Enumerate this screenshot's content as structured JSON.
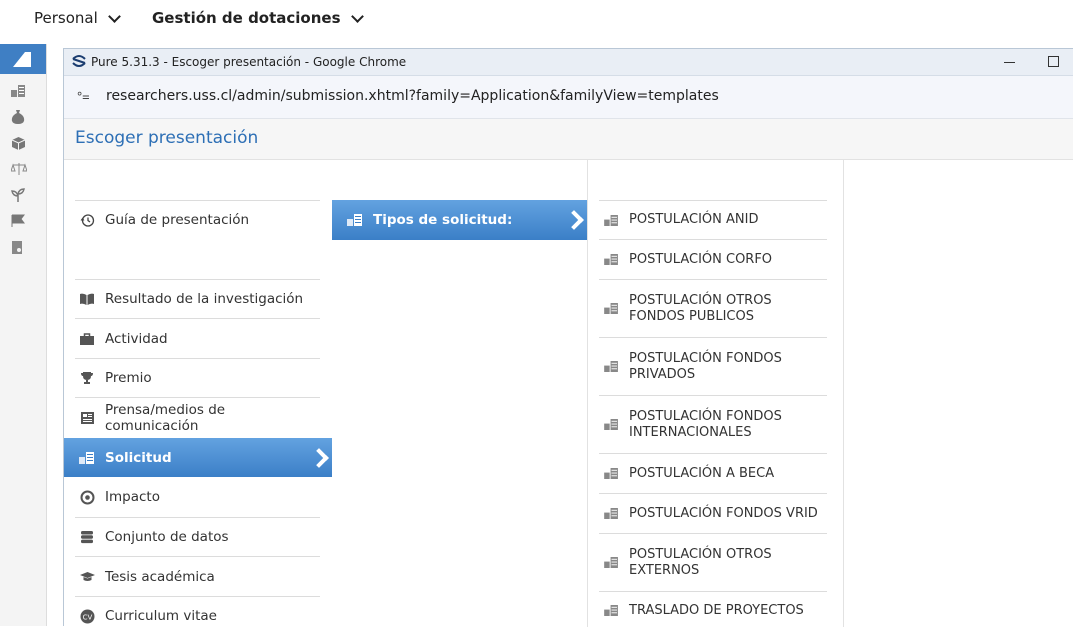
{
  "topnav": {
    "items": [
      {
        "label": "Personal",
        "bold": false
      },
      {
        "label": "Gestión de dotaciones",
        "bold": true
      }
    ]
  },
  "rail": {
    "icons": [
      "profile-icon",
      "application-icon",
      "funding-icon",
      "equipment-icon",
      "ethics-icon",
      "plant-icon",
      "flag-icon",
      "report-icon"
    ]
  },
  "browser": {
    "window_title": "Pure 5.31.3 - Escoger presentación - Google Chrome",
    "url": "researchers.uss.cl/admin/submission.xhtml?family=Application&familyView=templates"
  },
  "dialog": {
    "title": "Escoger presentación"
  },
  "col1": {
    "guide": {
      "label": "Guía de presentación",
      "icon": "history-icon"
    },
    "items": [
      {
        "label": "Resultado de la investigación",
        "icon": "book-icon"
      },
      {
        "label": "Actividad",
        "icon": "briefcase-icon"
      },
      {
        "label": "Premio",
        "icon": "trophy-icon"
      },
      {
        "label": "Prensa/medios de comunicación",
        "icon": "newspaper-icon"
      },
      {
        "label": "Solicitud",
        "icon": "application-icon",
        "selected": true
      },
      {
        "label": "Impacto",
        "icon": "target-icon"
      },
      {
        "label": "Conjunto de datos",
        "icon": "database-icon"
      },
      {
        "label": "Tesis académica",
        "icon": "graduation-cap-icon"
      },
      {
        "label": "Curriculum vitae",
        "icon": "cv-icon"
      }
    ]
  },
  "col2": {
    "items": [
      {
        "label": "Tipos de solicitud:",
        "selected": true
      }
    ]
  },
  "col3": {
    "items": [
      {
        "label": "POSTULACIÓN ANID"
      },
      {
        "label": "POSTULACIÓN CORFO"
      },
      {
        "label": "POSTULACIÓN OTROS FONDOS PUBLICOS"
      },
      {
        "label": "POSTULACIÓN FONDOS PRIVADOS"
      },
      {
        "label": "POSTULACIÓN FONDOS INTERNACIONALES"
      },
      {
        "label": "POSTULACIÓN A BECA"
      },
      {
        "label": "POSTULACIÓN FONDOS VRID"
      },
      {
        "label": "POSTULACIÓN OTROS EXTERNOS"
      },
      {
        "label": "TRASLADO DE PROYECTOS"
      }
    ]
  }
}
